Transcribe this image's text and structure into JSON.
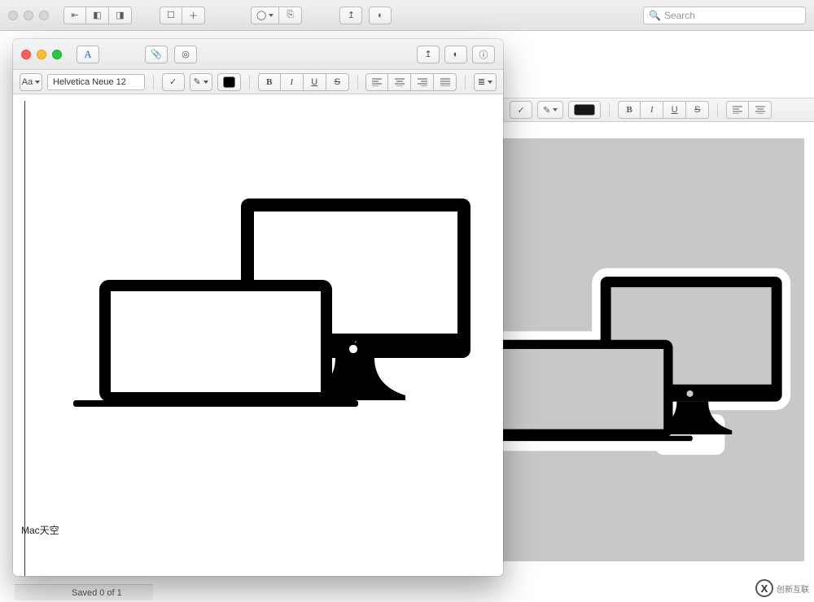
{
  "search": {
    "placeholder": "Search"
  },
  "front": {
    "aa": "Aa",
    "font_label": "Helvetica Neue 12",
    "letter_a": "A",
    "b": "B",
    "i": "I",
    "u": "U",
    "s": "S",
    "note_text": "Mac天空"
  },
  "back": {
    "b": "B",
    "i": "I",
    "u": "U",
    "s": "S"
  },
  "status": {
    "text": "Saved 0 of 1"
  },
  "corner": {
    "mark": "X",
    "text": "创新互联"
  },
  "icons": {
    "check": "✓",
    "pencil": "✎",
    "share": "↥",
    "info": "ⓘ",
    "clip": "📎",
    "compass": "◎",
    "list": "≣",
    "circle": "◯",
    "plus": "＋",
    "box": "☐",
    "user": "◐",
    "magnifier": "🔍",
    "tray": "⎘",
    "panel_l": "◧",
    "panel_r": "◨",
    "collapse": "⇤"
  }
}
